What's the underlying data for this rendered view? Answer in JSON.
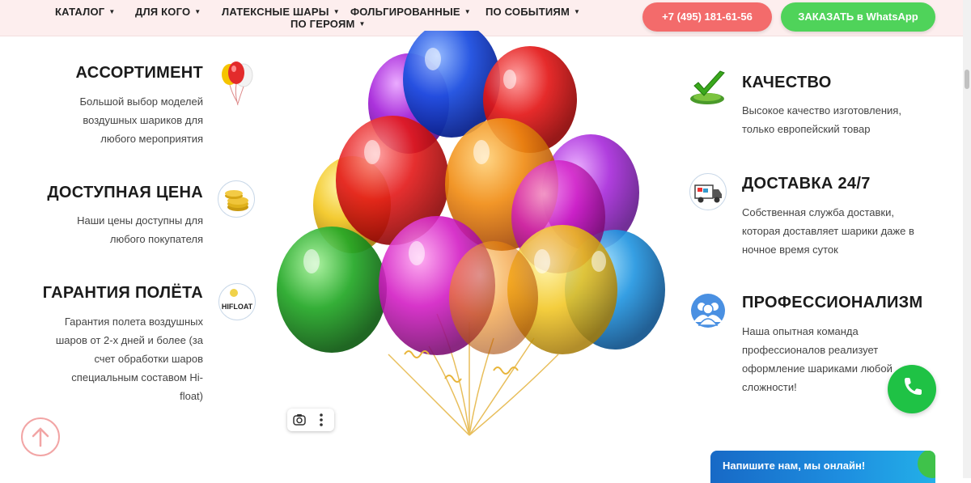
{
  "nav": {
    "items": [
      {
        "label": "КАТАЛОГ",
        "caret": "▼"
      },
      {
        "label": "ДЛЯ КОГО",
        "caret": "▼"
      },
      {
        "label": "ЛАТЕКСНЫЕ ШАРЫ",
        "caret": "▼"
      },
      {
        "label": "ФОЛЬГИРОВАННЫЕ",
        "caret": "▼"
      },
      {
        "label": "ПО СОБЫТИЯМ",
        "caret": "▼"
      },
      {
        "label": "ПО ГЕРОЯМ",
        "caret": "▼"
      }
    ],
    "phone_label": "+7 (495) 181-61-56",
    "whatsapp_label": "ЗАКАЗАТЬ в WhatsApp"
  },
  "features": {
    "left": [
      {
        "title": "АССОРТИМЕНТ",
        "desc": [
          "Большой выбор моделей",
          "воздушных шариков для",
          "любого мероприятия"
        ],
        "icon": "balloons-icon"
      },
      {
        "title": "ДОСТУПНАЯ ЦЕНА",
        "desc": [
          "Наши цены доступны для",
          "любого покупателя"
        ],
        "icon": "coins-icon"
      },
      {
        "title": "ГАРАНТИЯ ПОЛЁТА",
        "desc": [
          "Гарантия полета воздушных",
          "шаров от 2-х дней и более (за",
          "счет обработки шаров",
          "специальным составом Hi-",
          "float)"
        ],
        "icon": "hifloat-icon",
        "icon_text": "HIFLOAT"
      }
    ],
    "right": [
      {
        "title": "КАЧЕСТВО",
        "desc": [
          "Высокое качество изготовления,",
          "только европейский товар"
        ],
        "icon": "checkmark-icon"
      },
      {
        "title": "ДОСТАВКА 24/7",
        "desc": [
          "Собственная служба доставки,",
          "которая доставляет шарики даже в",
          "ночное время суток"
        ],
        "icon": "truck-icon"
      },
      {
        "title": "ПРОФЕССИОНАЛИЗМ",
        "desc": [
          "Наша опытная команда",
          "профессионалов реализует",
          "оформление шариками любой",
          "сложности!"
        ],
        "icon": "team-icon"
      }
    ]
  },
  "chat": {
    "label": "Напишите нам, мы онлайн!"
  },
  "colors": {
    "header_bg": "#fdeeee",
    "phone_button": "#f36b6b",
    "whatsapp_button": "#4fd35a",
    "call_button": "#1fc245",
    "chat_widget": "#1769c6"
  }
}
